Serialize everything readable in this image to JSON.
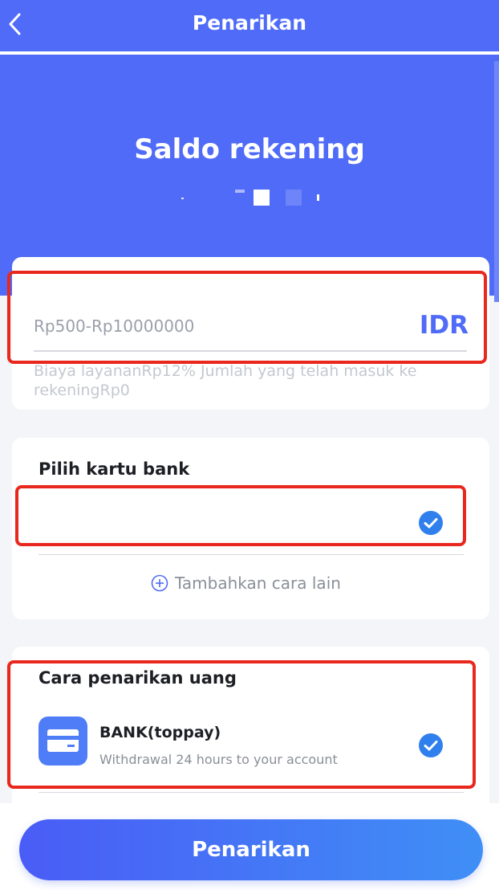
{
  "header": {
    "title": "Penarikan"
  },
  "balance": {
    "label": "Saldo rekening"
  },
  "amount": {
    "placeholder": "Rp500-Rp10000000",
    "currency": "IDR",
    "fee_note": "Biaya layananRp12% Jumlah yang telah masuk ke rekeningRp0"
  },
  "bank_card": {
    "title": "Pilih kartu bank",
    "add_other": "Tambahkan cara lain"
  },
  "withdraw_method": {
    "title": "Cara penarikan uang",
    "name": "BANK(toppay)",
    "description": "Withdrawal 24 hours to your account"
  },
  "submit_label": "Penarikan",
  "colors": {
    "primary": "#4f6bf7",
    "highlight": "#e8281d",
    "check": "#2f80ed"
  },
  "icons": {
    "back": "chevron-left-icon",
    "check": "check-circle-icon",
    "add": "plus-circle-icon",
    "method": "credit-card-icon"
  }
}
